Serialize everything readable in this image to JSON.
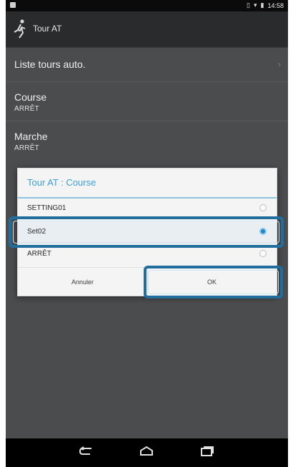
{
  "statusbar": {
    "time": "14:58",
    "icons": [
      "notification-icon",
      "vibrate-icon",
      "wifi-icon",
      "battery-icon"
    ]
  },
  "actionbar": {
    "title": "Tour AT",
    "icon": "running-person-icon"
  },
  "settings": {
    "items": [
      {
        "title": "Liste tours auto.",
        "subtitle": ""
      },
      {
        "title": "Course",
        "subtitle": "ARRÊT"
      },
      {
        "title": "Marche",
        "subtitle": "ARRÊT"
      }
    ]
  },
  "dialog": {
    "title": "Tour AT : Course",
    "options": [
      {
        "label": "SETTING01",
        "selected": false
      },
      {
        "label": "Set02",
        "selected": true
      },
      {
        "label": "ARRÊT",
        "selected": false
      }
    ],
    "cancel_label": "Annuler",
    "ok_label": "OK"
  },
  "colors": {
    "dialog_title": "#3a9fd8",
    "radio_selected": "#1e88d0",
    "highlight_frame": "#1f6e9d"
  }
}
